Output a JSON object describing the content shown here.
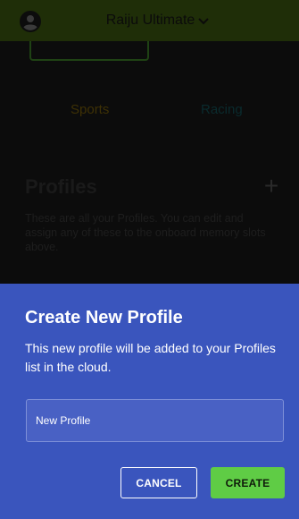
{
  "header": {
    "title": "Raiju Ultimate",
    "icons": [
      "avatar-icon",
      "chevron-down-icon"
    ]
  },
  "modes": {
    "sports": "Sports",
    "racing": "Racing"
  },
  "profiles": {
    "heading": "Profiles",
    "add_icon": "+",
    "description": "These are all your Profiles. You can edit and assign any of these to the onboard memory slots above."
  },
  "modal": {
    "title": "Create New Profile",
    "description": "This new profile will be added to your Profiles list in the cloud.",
    "input_value": "New Profile",
    "cancel_label": "CANCEL",
    "create_label": "CREATE"
  },
  "colors": {
    "header_bg": "#1f2e08",
    "sheet_bg": "#3a55bd",
    "create_button": "#5fcc45"
  }
}
